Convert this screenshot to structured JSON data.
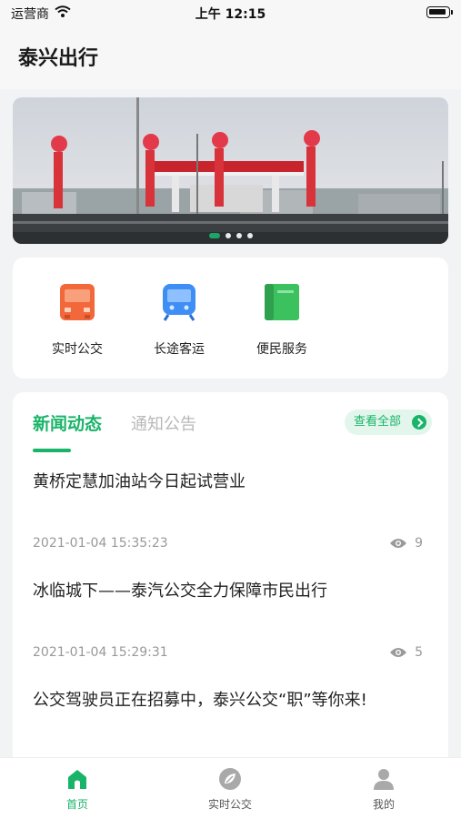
{
  "status_bar": {
    "carrier": "运营商",
    "time": "上午 12:15"
  },
  "header": {
    "title": "泰兴出行"
  },
  "services": [
    {
      "label": "实时公交",
      "icon": "bus-icon",
      "color": "#f2683a"
    },
    {
      "label": "长途客运",
      "icon": "coach-icon",
      "color": "#3f8ef5"
    },
    {
      "label": "便民服务",
      "icon": "book-icon",
      "color": "#3cc15f"
    }
  ],
  "news_section": {
    "tabs": [
      "新闻动态",
      "通知公告"
    ],
    "view_all": "查看全部",
    "items": [
      {
        "title": "黄桥定慧加油站今日起试营业",
        "time": "2021-01-04 15:35:23",
        "views": "9"
      },
      {
        "title": "冰临城下——泰汽公交全力保障市民出行",
        "time": "2021-01-04 15:29:31",
        "views": "5"
      },
      {
        "title": "公交驾驶员正在招募中，泰兴公交“职”等你来!"
      }
    ]
  },
  "tabbar": [
    {
      "label": "首页",
      "icon": "home-icon",
      "active": true
    },
    {
      "label": "实时公交",
      "icon": "leaf-icon",
      "active": false
    },
    {
      "label": "我的",
      "icon": "user-icon",
      "active": false
    }
  ],
  "colors": {
    "accent": "#19b46a",
    "inactive": "#999999"
  }
}
